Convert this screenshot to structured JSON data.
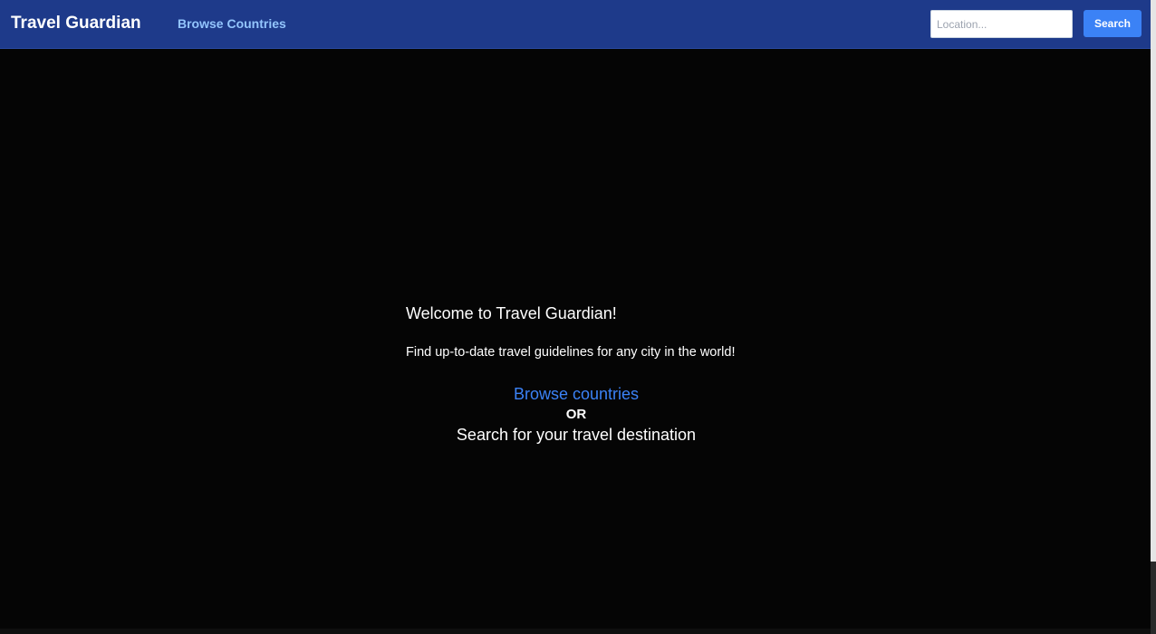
{
  "header": {
    "brand": "Travel Guardian",
    "nav_browse": "Browse Countries",
    "search": {
      "placeholder": "Location...",
      "value": "",
      "button_label": "Search"
    }
  },
  "hero": {
    "welcome": "Welcome to Travel Guardian!",
    "tagline": "Find up-to-date travel guidelines for any city in the world!",
    "browse_link": "Browse countries",
    "or": "OR",
    "search_prompt": "Search for your travel destination"
  },
  "colors": {
    "navbar_bg": "#1e3a8a",
    "page_bg": "#050505",
    "accent": "#3b82f6",
    "nav_link": "#93c5fd"
  }
}
